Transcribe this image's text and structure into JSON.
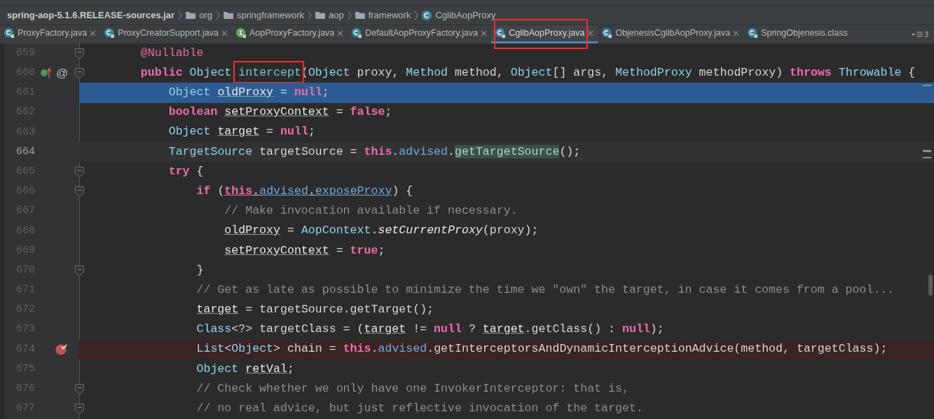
{
  "breadcrumb": [
    {
      "label": "spring-aop-5.1.6.RELEASE-sources.jar",
      "kind": "jar"
    },
    {
      "label": "org",
      "kind": "folder"
    },
    {
      "label": "springframework",
      "kind": "folder"
    },
    {
      "label": "aop",
      "kind": "folder"
    },
    {
      "label": "framework",
      "kind": "folder"
    },
    {
      "label": "CglibAopProxy",
      "kind": "class"
    }
  ],
  "tabs": [
    {
      "label": "ProxyFactory.java",
      "kind": "class",
      "selected": false,
      "closable": true,
      "boxed": false
    },
    {
      "label": "ProxyCreatorSupport.java",
      "kind": "class",
      "selected": false,
      "closable": true,
      "boxed": false
    },
    {
      "label": "AopProxyFactory.java",
      "kind": "interface",
      "selected": false,
      "closable": true,
      "boxed": false
    },
    {
      "label": "DefaultAopProxyFactory.java",
      "kind": "class",
      "selected": false,
      "closable": true,
      "boxed": false
    },
    {
      "label": "CglibAopProxy.java",
      "kind": "class",
      "selected": true,
      "closable": true,
      "boxed": true
    },
    {
      "label": "ObjenesisCglibAopProxy.java",
      "kind": "class",
      "selected": false,
      "closable": true,
      "boxed": false
    },
    {
      "label": "SpringObjenesis.class",
      "kind": "class",
      "selected": false,
      "closable": false,
      "boxed": false
    }
  ],
  "tab_overflow": "3",
  "lines": [
    {
      "number": "659",
      "selected": false,
      "caret_line": false,
      "breakpoint": false,
      "implements": false,
      "fold": true,
      "tokens": [
        {
          "t": "    @Nullable",
          "kind": "annotation"
        }
      ]
    },
    {
      "number": "660",
      "selected": false,
      "caret_line": false,
      "breakpoint": false,
      "implements": true,
      "gutter_text": "@",
      "fold": true,
      "tokens": [
        {
          "t": "    public ",
          "kind": "keyword"
        },
        {
          "t": "Object ",
          "kind": "type"
        },
        {
          "t": "intercept",
          "kind": "method",
          "boxed": true
        },
        {
          "t": "(",
          "kind": "plain"
        },
        {
          "t": "Object",
          "kind": "type"
        },
        {
          "t": " proxy, ",
          "kind": "plain"
        },
        {
          "t": "Method",
          "kind": "type"
        },
        {
          "t": " method, ",
          "kind": "plain"
        },
        {
          "t": "Object",
          "kind": "type"
        },
        {
          "t": "[] args, ",
          "kind": "plain"
        },
        {
          "t": "MethodProxy",
          "kind": "type"
        },
        {
          "t": " methodProxy) ",
          "kind": "plain"
        },
        {
          "t": "throws ",
          "kind": "keyword"
        },
        {
          "t": "Throwable",
          "kind": "type"
        },
        {
          "t": " {",
          "kind": "plain"
        }
      ]
    },
    {
      "number": "661",
      "selected": true,
      "caret_line": false,
      "breakpoint": false,
      "implements": false,
      "fold": false,
      "tokens": [
        {
          "t": "        Object ",
          "kind": "type"
        },
        {
          "t": "oldProxy",
          "kind": "variable"
        },
        {
          "t": " = ",
          "kind": "plain"
        },
        {
          "t": "null",
          "kind": "keyword"
        },
        {
          "t": ";",
          "kind": "plain"
        }
      ]
    },
    {
      "number": "662",
      "selected": false,
      "caret_line": false,
      "breakpoint": false,
      "implements": false,
      "fold": false,
      "tokens": [
        {
          "t": "        boolean ",
          "kind": "keyword"
        },
        {
          "t": "setProxyContext",
          "kind": "variable"
        },
        {
          "t": " = ",
          "kind": "plain"
        },
        {
          "t": "false",
          "kind": "keyword"
        },
        {
          "t": ";",
          "kind": "plain"
        }
      ]
    },
    {
      "number": "663",
      "selected": false,
      "caret_line": false,
      "breakpoint": false,
      "implements": false,
      "fold": false,
      "tokens": [
        {
          "t": "        Object ",
          "kind": "type"
        },
        {
          "t": "target",
          "kind": "variable"
        },
        {
          "t": " = ",
          "kind": "plain"
        },
        {
          "t": "null",
          "kind": "keyword"
        },
        {
          "t": ";",
          "kind": "plain"
        }
      ]
    },
    {
      "number": "664",
      "selected": false,
      "caret_line": true,
      "breakpoint": false,
      "implements": false,
      "fold": false,
      "tokens": [
        {
          "t": "        TargetSource",
          "kind": "type"
        },
        {
          "t": " targetSource = ",
          "kind": "plain"
        },
        {
          "t": "this",
          "kind": "keyword"
        },
        {
          "t": ".",
          "kind": "plain"
        },
        {
          "t": "advised",
          "kind": "field"
        },
        {
          "t": ".",
          "kind": "plain"
        },
        {
          "t": "getTargetSource",
          "kind": "usage"
        },
        {
          "t": "();",
          "kind": "plain"
        }
      ]
    },
    {
      "number": "665",
      "selected": false,
      "caret_line": false,
      "breakpoint": false,
      "implements": false,
      "fold": true,
      "tokens": [
        {
          "t": "        try",
          "kind": "keyword"
        },
        {
          "t": " {",
          "kind": "plain"
        }
      ]
    },
    {
      "number": "666",
      "selected": false,
      "caret_line": false,
      "breakpoint": false,
      "implements": false,
      "fold": true,
      "tokens": [
        {
          "t": "            if",
          "kind": "keyword"
        },
        {
          "t": " (",
          "kind": "plain"
        },
        {
          "t": "this",
          "kind": "keyword_underlined"
        },
        {
          "t": ".",
          "kind": "plain_underlined"
        },
        {
          "t": "advised",
          "kind": "field_underlined"
        },
        {
          "t": ".",
          "kind": "plain_underlined"
        },
        {
          "t": "exposeProxy",
          "kind": "field_underlined"
        },
        {
          "t": ") {",
          "kind": "plain"
        }
      ]
    },
    {
      "number": "667",
      "selected": false,
      "caret_line": false,
      "breakpoint": false,
      "implements": false,
      "fold": false,
      "tokens": [
        {
          "t": "                // Make invocation available if necessary.",
          "kind": "comment"
        }
      ]
    },
    {
      "number": "668",
      "selected": false,
      "caret_line": false,
      "breakpoint": false,
      "implements": false,
      "fold": false,
      "tokens": [
        {
          "t": "                oldProxy",
          "kind": "variable"
        },
        {
          "t": " = ",
          "kind": "plain"
        },
        {
          "t": "AopContext",
          "kind": "type"
        },
        {
          "t": ".",
          "kind": "plain"
        },
        {
          "t": "setCurrentProxy",
          "kind": "static"
        },
        {
          "t": "(proxy);",
          "kind": "plain"
        }
      ]
    },
    {
      "number": "669",
      "selected": false,
      "caret_line": false,
      "breakpoint": false,
      "implements": false,
      "fold": false,
      "tokens": [
        {
          "t": "                setProxyContext",
          "kind": "variable"
        },
        {
          "t": " = ",
          "kind": "plain"
        },
        {
          "t": "true",
          "kind": "keyword"
        },
        {
          "t": ";",
          "kind": "plain"
        }
      ]
    },
    {
      "number": "670",
      "selected": false,
      "caret_line": false,
      "breakpoint": false,
      "implements": false,
      "fold": true,
      "tokens": [
        {
          "t": "            }",
          "kind": "plain"
        }
      ]
    },
    {
      "number": "671",
      "selected": false,
      "caret_line": false,
      "breakpoint": false,
      "implements": false,
      "fold": false,
      "tokens": [
        {
          "t": "            // Get as late as possible to minimize the time we \"own\" the target, in case it comes from a pool...",
          "kind": "comment"
        }
      ]
    },
    {
      "number": "672",
      "selected": false,
      "caret_line": false,
      "breakpoint": false,
      "implements": false,
      "fold": false,
      "tokens": [
        {
          "t": "            target",
          "kind": "variable"
        },
        {
          "t": " = targetSource.getTarget();",
          "kind": "plain"
        }
      ]
    },
    {
      "number": "673",
      "selected": false,
      "caret_line": false,
      "breakpoint": false,
      "implements": false,
      "fold": false,
      "tokens": [
        {
          "t": "            Class",
          "kind": "type"
        },
        {
          "t": "<?> targetClass = (",
          "kind": "plain"
        },
        {
          "t": "target",
          "kind": "variable"
        },
        {
          "t": " != ",
          "kind": "plain"
        },
        {
          "t": "null",
          "kind": "keyword"
        },
        {
          "t": " ? ",
          "kind": "plain"
        },
        {
          "t": "target",
          "kind": "variable"
        },
        {
          "t": ".getClass() : ",
          "kind": "plain"
        },
        {
          "t": "null",
          "kind": "keyword"
        },
        {
          "t": ");",
          "kind": "plain"
        }
      ]
    },
    {
      "number": "674",
      "selected": false,
      "caret_line": false,
      "breakpoint": true,
      "implements": false,
      "fold": false,
      "tokens": [
        {
          "t": "            List",
          "kind": "type"
        },
        {
          "t": "<",
          "kind": "plain"
        },
        {
          "t": "Object",
          "kind": "type"
        },
        {
          "t": "> chain = ",
          "kind": "plain"
        },
        {
          "t": "this",
          "kind": "keyword"
        },
        {
          "t": ".",
          "kind": "plain"
        },
        {
          "t": "advised",
          "kind": "field"
        },
        {
          "t": ".getInterceptorsAndDynamicInterceptionAdvice(method, targetClass);",
          "kind": "plain"
        }
      ]
    },
    {
      "number": "675",
      "selected": false,
      "caret_line": false,
      "breakpoint": false,
      "implements": false,
      "fold": false,
      "tokens": [
        {
          "t": "            Object ",
          "kind": "type"
        },
        {
          "t": "retVal",
          "kind": "variable"
        },
        {
          "t": ";",
          "kind": "plain"
        }
      ]
    },
    {
      "number": "676",
      "selected": false,
      "caret_line": false,
      "breakpoint": false,
      "implements": false,
      "fold": true,
      "tokens": [
        {
          "t": "            // Check whether we only have one InvokerInterceptor: that is,",
          "kind": "comment"
        }
      ]
    },
    {
      "number": "677",
      "selected": false,
      "caret_line": false,
      "breakpoint": false,
      "implements": false,
      "fold": true,
      "tokens": [
        {
          "t": "            // no real advice, but just reflective invocation of the target.",
          "kind": "comment"
        }
      ]
    }
  ]
}
